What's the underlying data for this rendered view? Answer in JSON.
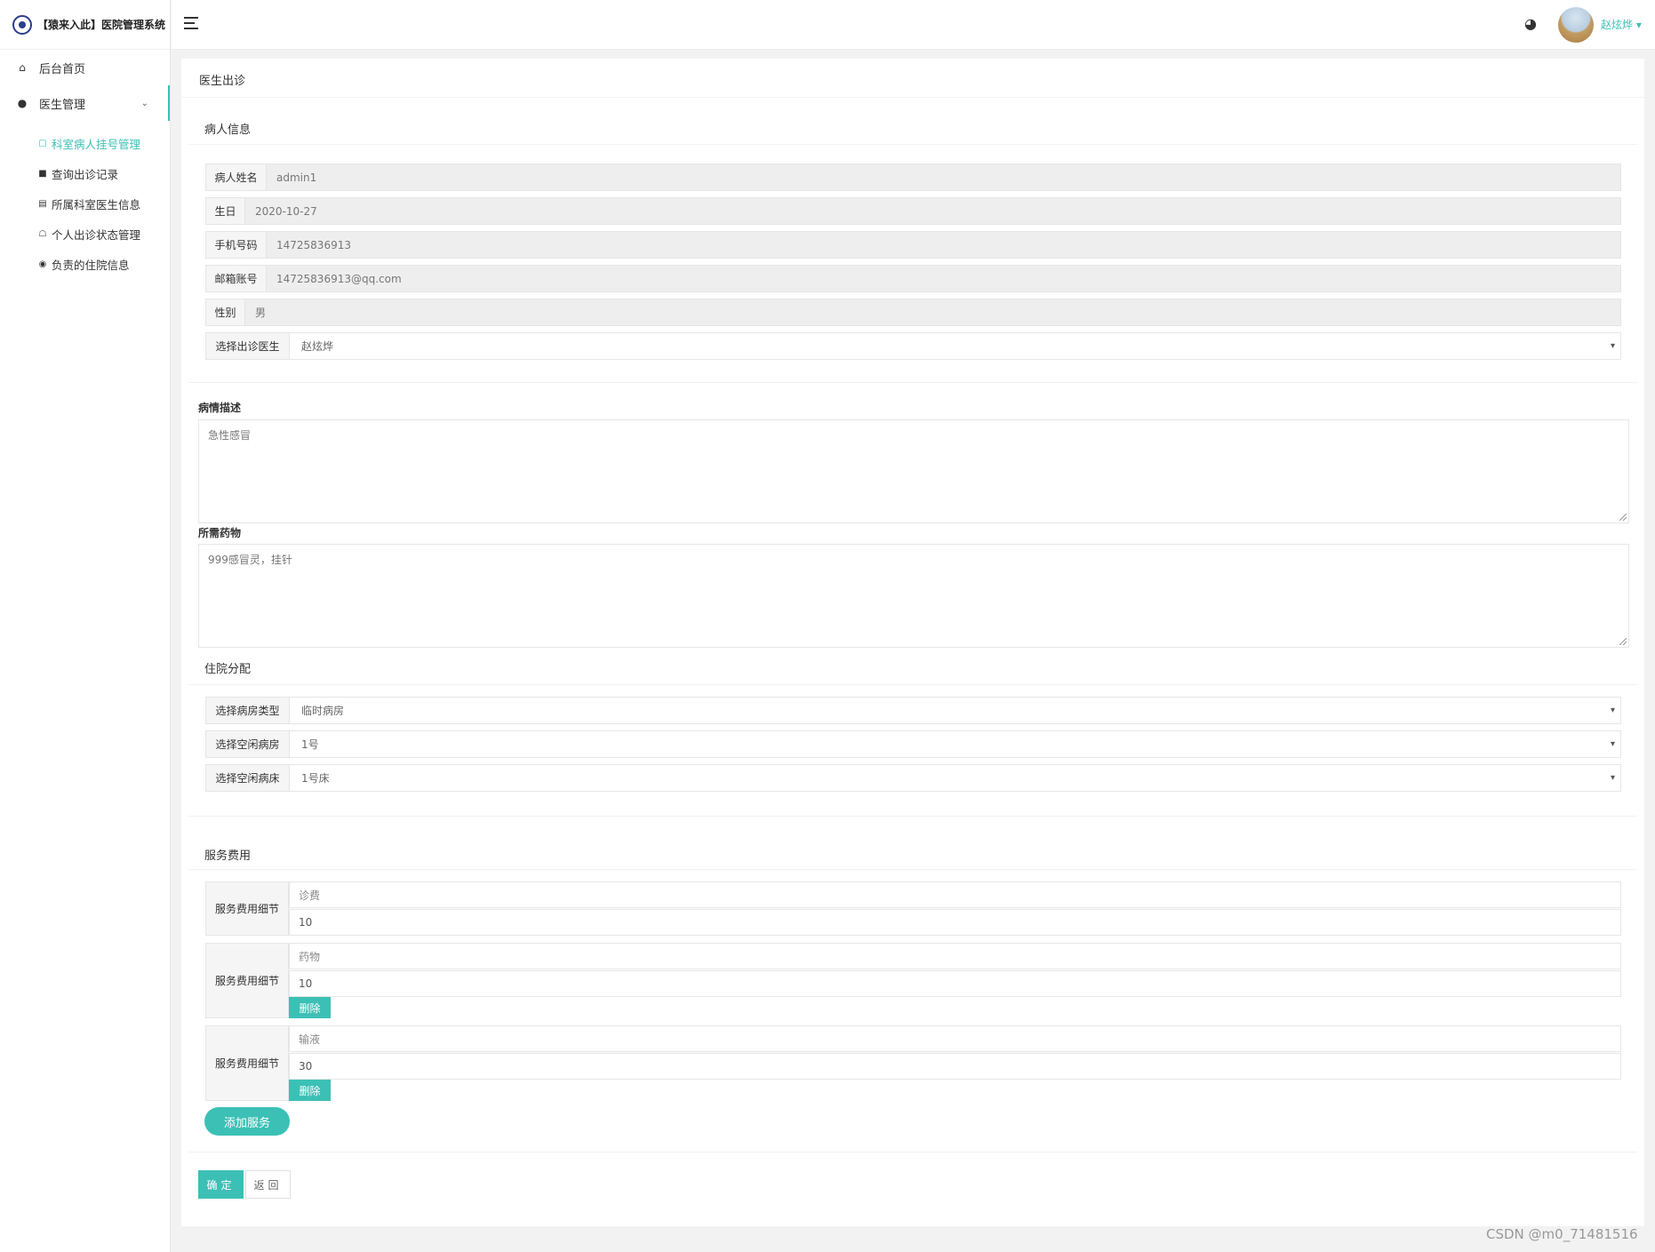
{
  "brand": {
    "title": "【猿来入此】医院管理系统"
  },
  "header": {
    "username": "赵炫烨",
    "user_caret": "▾"
  },
  "sidebar": {
    "items": [
      {
        "label": "后台首页",
        "icon": "home-icon"
      },
      {
        "label": "医生管理",
        "icon": "doctor-icon",
        "caret": "⌄"
      }
    ],
    "subitems": [
      {
        "label": "科室病人挂号管理",
        "icon": "register-icon",
        "active": true
      },
      {
        "label": "查询出诊记录",
        "icon": "comment-icon"
      },
      {
        "label": "所属科室医生信息",
        "icon": "document-icon"
      },
      {
        "label": "个人出诊状态管理",
        "icon": "person-walk-icon"
      },
      {
        "label": "负责的住院信息",
        "icon": "user-circle-icon"
      }
    ]
  },
  "page": {
    "title": "医生出诊",
    "patient_section": "病人信息",
    "patient": {
      "name_label": "病人姓名",
      "name": "admin1",
      "birth_label": "生日",
      "birth": "2020-10-27",
      "phone_label": "手机号码",
      "phone": "14725836913",
      "email_label": "邮箱账号",
      "email": "14725836913@qq.com",
      "gender_label": "性别",
      "gender": "男",
      "doctor_label": "选择出诊医生",
      "doctor": "赵炫烨"
    },
    "description_label": "病情描述",
    "description": "急性感冒",
    "medicine_label": "所需药物",
    "medicine": "999感冒灵，挂针",
    "hospital_section": "住院分配",
    "hospital": {
      "room_type_label": "选择病房类型",
      "room_type": "临时病房",
      "room_label": "选择空闲病房",
      "room": "1号",
      "bed_label": "选择空闲病床",
      "bed": "1号床"
    },
    "fee_section": "服务费用",
    "fee_label": "服务费用细节",
    "fees": [
      {
        "name": "诊费",
        "amount": "10"
      },
      {
        "name": "药物",
        "amount": "10"
      },
      {
        "name": "输液",
        "amount": "30"
      }
    ],
    "delete_label": "删除",
    "add_service_label": "添加服务",
    "confirm_label": "确定",
    "back_label": "返回"
  },
  "watermark": "CSDN @m0_71481516",
  "colors": {
    "accent": "#3cc0b5",
    "readonly_bg": "#eeeeee",
    "label_bg": "#f5f5f5"
  }
}
